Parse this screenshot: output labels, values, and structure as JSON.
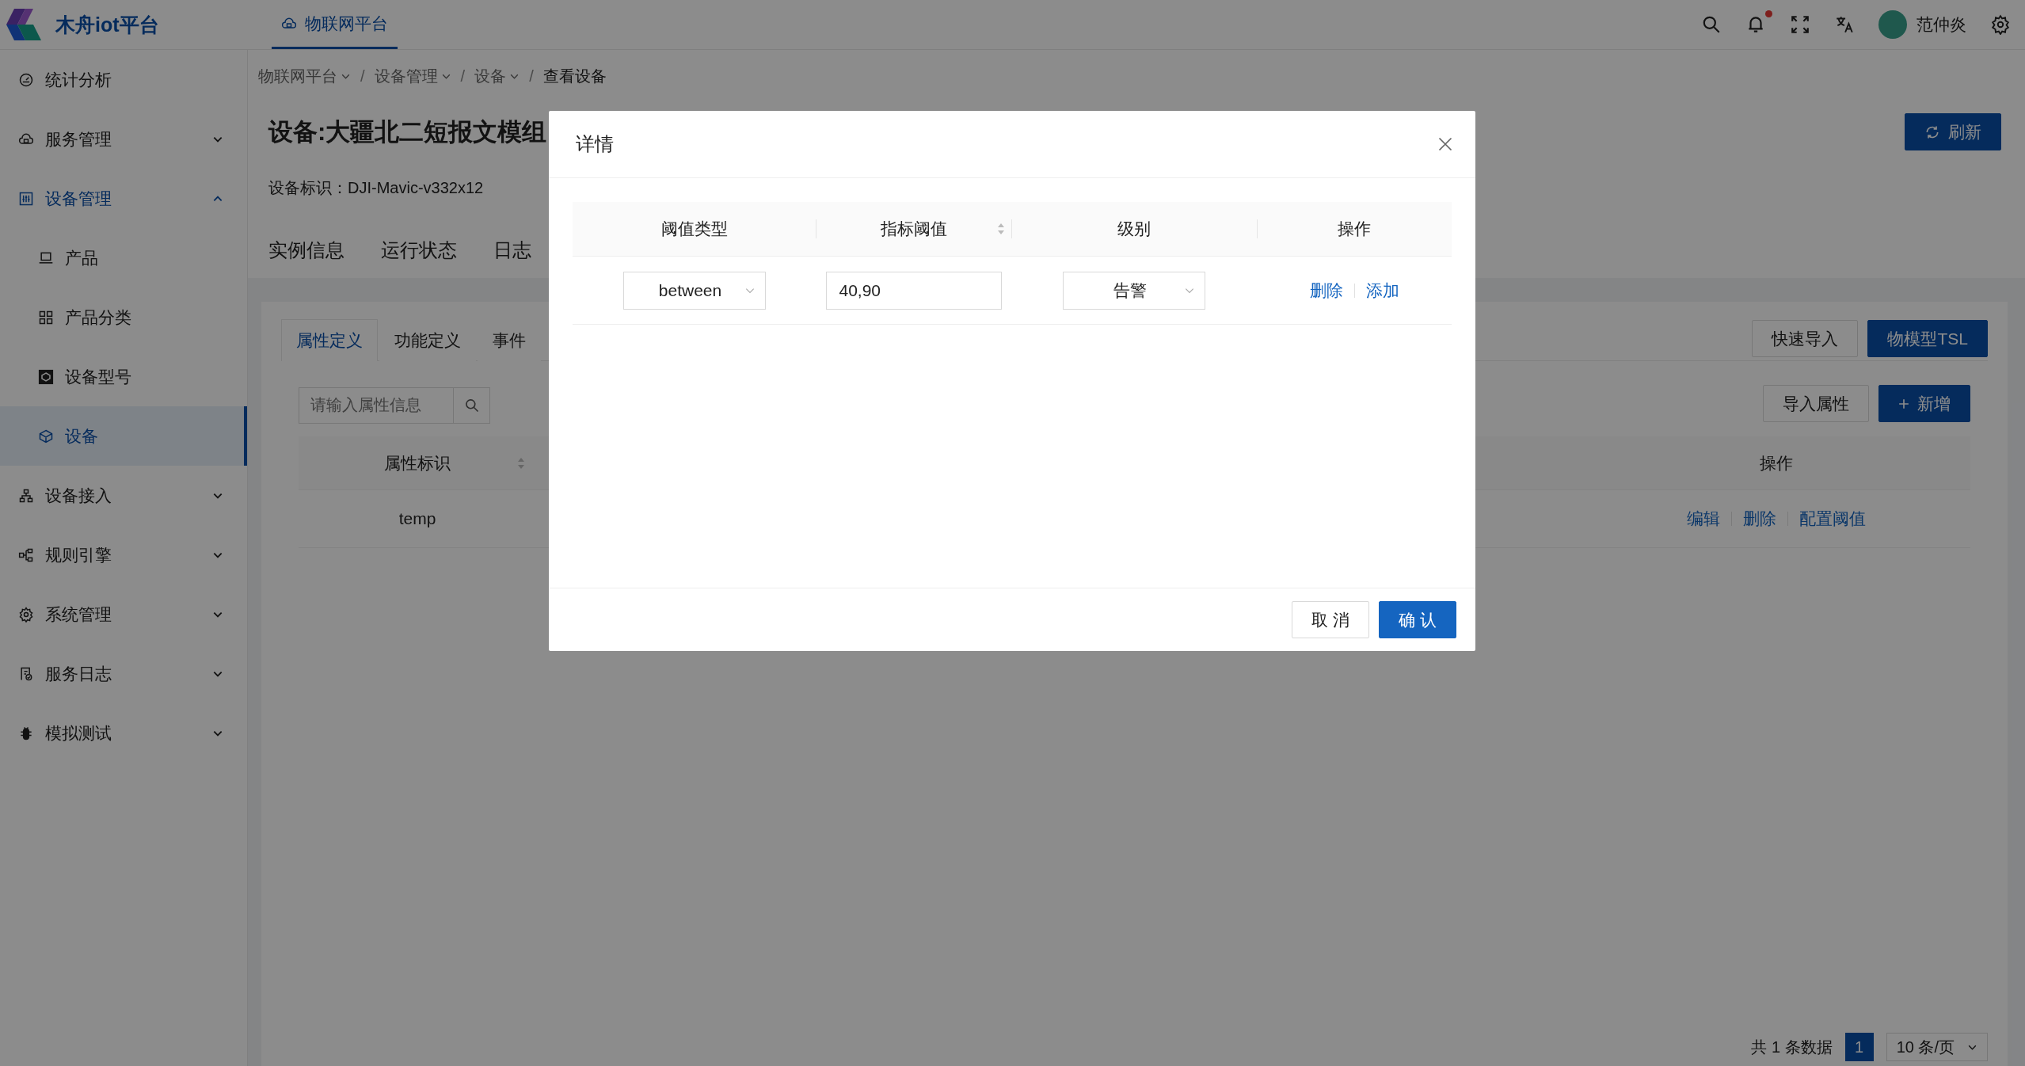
{
  "app": {
    "name": "木舟iot平台"
  },
  "top_nav": [
    {
      "label": "物联网平台",
      "selected": true
    }
  ],
  "header": {
    "bell_unread": true,
    "user_name": "范仲炎"
  },
  "sidebar": {
    "items": [
      {
        "label": "统计分析",
        "kind": "link",
        "selected": false
      },
      {
        "label": "服务管理",
        "kind": "group",
        "selected": false,
        "expanded": false
      },
      {
        "label": "设备管理",
        "kind": "group",
        "selected": true,
        "expanded": true,
        "children": [
          {
            "label": "产品",
            "selected": false
          },
          {
            "label": "产品分类",
            "selected": false
          },
          {
            "label": "设备型号",
            "selected": false
          },
          {
            "label": "设备",
            "selected": true
          }
        ]
      },
      {
        "label": "设备接入",
        "kind": "group",
        "selected": false,
        "expanded": false
      },
      {
        "label": "规则引擎",
        "kind": "group",
        "selected": false,
        "expanded": false
      },
      {
        "label": "系统管理",
        "kind": "group",
        "selected": false,
        "expanded": false
      },
      {
        "label": "服务日志",
        "kind": "group",
        "selected": false,
        "expanded": false
      },
      {
        "label": "模拟测试",
        "kind": "group",
        "selected": false,
        "expanded": false
      }
    ]
  },
  "breadcrumb": {
    "separator": "/",
    "items": [
      {
        "label": "物联网平台",
        "dropdown": true
      },
      {
        "label": "设备管理",
        "dropdown": true
      },
      {
        "label": "设备",
        "dropdown": true
      },
      {
        "label": "查看设备",
        "dropdown": false
      }
    ]
  },
  "page": {
    "title": "设备:大疆北二短报文模组",
    "device_id": "设备标识：DJI-Mavic-v332x12",
    "refresh_button": "刷新",
    "tabs": [
      {
        "label": "实例信息",
        "selected": false
      },
      {
        "label": "运行状态",
        "selected": false
      },
      {
        "label": "日志",
        "selected": false
      }
    ]
  },
  "panel": {
    "tabs": [
      {
        "label": "属性定义",
        "selected": true
      },
      {
        "label": "功能定义",
        "selected": false
      },
      {
        "label": "事件",
        "selected": false
      }
    ],
    "top_buttons": [
      {
        "label": "快速导入",
        "kind": "default"
      },
      {
        "label": "物模型TSL",
        "kind": "primary"
      }
    ],
    "search": {
      "placeholder": "请输入属性信息"
    },
    "action_buttons": [
      {
        "label": "导入属性",
        "kind": "default"
      },
      {
        "label": "新增",
        "kind": "add"
      }
    ],
    "table": {
      "columns": [
        {
          "label": "属性标识",
          "sortable": true
        },
        {
          "label": "操作",
          "sortable": false
        }
      ],
      "rows": [
        {
          "id": "temp",
          "actions": [
            "编辑",
            "删除",
            "配置阈值"
          ]
        }
      ]
    },
    "pagination": {
      "total": "共 1 条数据",
      "pages": [
        {
          "label": "1",
          "selected": true
        }
      ],
      "page_size": "10 条/页"
    }
  },
  "dialog": {
    "title": "详情",
    "columns": [
      {
        "label": "阈值类型",
        "sortable": false
      },
      {
        "label": "指标阈值",
        "sortable": true
      },
      {
        "label": "级别",
        "sortable": false
      },
      {
        "label": "操作",
        "sortable": false
      }
    ],
    "rows": [
      {
        "type": "between",
        "value": "40,90",
        "level": "告警",
        "actions": [
          "删除",
          "添加"
        ]
      }
    ],
    "buttons": [
      {
        "label": "取 消",
        "kind": "default"
      },
      {
        "label": "确 认",
        "kind": "primary"
      }
    ]
  }
}
